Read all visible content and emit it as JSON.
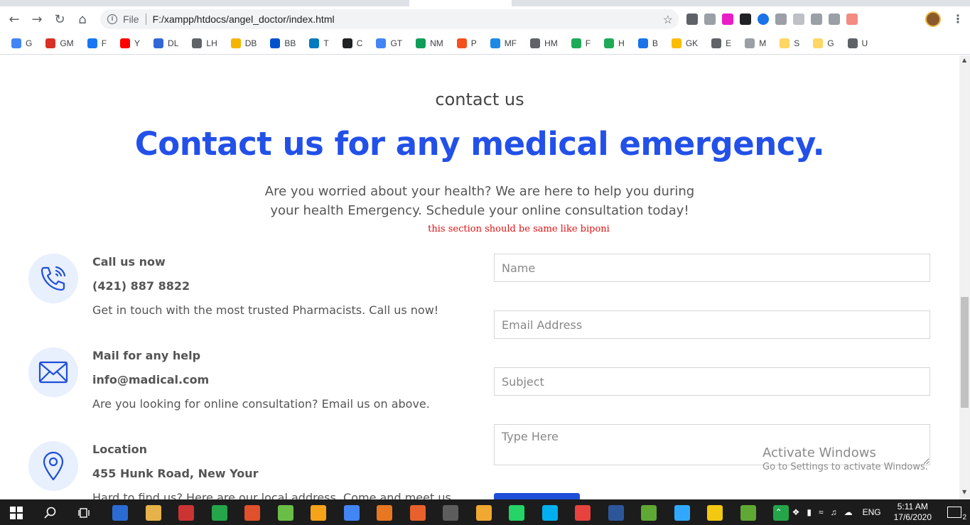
{
  "browser": {
    "address": {
      "scheme_label": "File",
      "url": "F:/xampp/htdocs/angel_doctor/index.html"
    },
    "bookmarks": [
      {
        "label": "G",
        "color": "#4285f4"
      },
      {
        "label": "GM",
        "color": "#d93025"
      },
      {
        "label": "F",
        "color": "#1877f2"
      },
      {
        "label": "Y",
        "color": "#ff0000"
      },
      {
        "label": "DL",
        "color": "#3367d6"
      },
      {
        "label": "LH",
        "color": "#5f6368"
      },
      {
        "label": "DB",
        "color": "#f4b400"
      },
      {
        "label": "BB",
        "color": "#0052cc"
      },
      {
        "label": "T",
        "color": "#0079bf"
      },
      {
        "label": "C",
        "color": "#202124"
      },
      {
        "label": "GT",
        "color": "#4285f4"
      },
      {
        "label": "NM",
        "color": "#0f9d58"
      },
      {
        "label": "P",
        "color": "#f4511e"
      },
      {
        "label": "MF",
        "color": "#1e88e5"
      },
      {
        "label": "HM",
        "color": "#5f6368"
      },
      {
        "label": "F",
        "color": "#1faa59"
      },
      {
        "label": "H",
        "color": "#1faa59"
      },
      {
        "label": "B",
        "color": "#1a73e8"
      },
      {
        "label": "GK",
        "color": "#fbbc04"
      },
      {
        "label": "E",
        "color": "#5f6368"
      },
      {
        "label": "M",
        "color": "#9aa0a6"
      },
      {
        "label": "S",
        "color": "#fdd663"
      },
      {
        "label": "G",
        "color": "#fdd663"
      },
      {
        "label": "U",
        "color": "#5f6368"
      }
    ]
  },
  "section": {
    "eyebrow": "contact us",
    "headline": "Contact us for any medical emergency.",
    "lead_line1": "Are you worried about your health? We are here to help you during",
    "lead_line2": "your health Emergency. Schedule your online consultation today!",
    "note": "this section should be same like biponi"
  },
  "contacts": [
    {
      "icon": "phone-icon",
      "title": "Call us now",
      "value": "(421) 887 8822",
      "desc": "Get in touch with the most trusted Pharmacists. Call us now!"
    },
    {
      "icon": "mail-icon",
      "title": "Mail for any help",
      "value": "info@madical.com",
      "desc": "Are you looking for online consultation? Email us on above."
    },
    {
      "icon": "location-pin-icon",
      "title": "Location",
      "value": "455 Hunk Road, New Your",
      "desc": "Hard to find us? Here are our local address. Come and meet us."
    }
  ],
  "form": {
    "name_placeholder": "Name",
    "email_placeholder": "Email Address",
    "subject_placeholder": "Subject",
    "message_placeholder": "Type Here"
  },
  "watermark": {
    "line1": "Activate Windows",
    "line2": "Go to Settings to activate Windows."
  },
  "taskbar": {
    "language": "ENG",
    "time": "5:11 AM",
    "date": "17/6/2020",
    "notification_count": "2",
    "app_colors": [
      "#2b6cd4",
      "#e6b24a",
      "#cc3333",
      "#25a54a",
      "#e0502c",
      "#6abe45",
      "#f6a31a",
      "#4285f4",
      "#e87722",
      "#e8612c",
      "#5d5d5d",
      "#f0a830",
      "#25d366",
      "#00aff0",
      "#e8423f",
      "#2b579a",
      "#5fa834",
      "#31a8ff",
      "#f2c811",
      "#5fa834",
      "#25a54a"
    ]
  }
}
